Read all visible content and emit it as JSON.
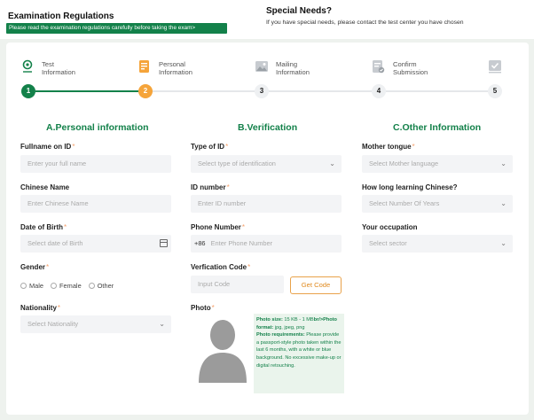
{
  "header": {
    "reg_title": "Examination Regulations",
    "reg_note": "Please read the examination regulations carefully before taking the exam>",
    "special_title": "Special Needs?",
    "special_text": "If you have special needs, please contact the test center you have chosen"
  },
  "steps": [
    {
      "label1": "Test",
      "label2": "Information",
      "number": "1",
      "icon": "location-pin-icon"
    },
    {
      "label1": "Personal",
      "label2": "Information",
      "number": "2",
      "icon": "document-icon"
    },
    {
      "label1": "Mailing",
      "label2": "Information",
      "number": "3",
      "icon": "picture-icon"
    },
    {
      "label1": "Confirm",
      "label2": "Submission",
      "number": "4",
      "icon": "check-document-icon"
    },
    {
      "label1": "",
      "label2": "",
      "number": "5",
      "icon": "checkbox-icon"
    }
  ],
  "colors": {
    "green": "#13814a",
    "orange": "#f5a43a",
    "grey": "#e5e7ea"
  },
  "sections": {
    "a": "A.Personal information",
    "b": "B.Verification",
    "c": "C.Other Information"
  },
  "fields": {
    "fullname": {
      "label": "Fullname on ID",
      "required": "*",
      "placeholder": "Enter your full name"
    },
    "chinese_name": {
      "label": "Chinese Name",
      "placeholder": "Enter Chinese Name"
    },
    "dob": {
      "label": "Date of Birth",
      "required": "*",
      "placeholder": "Select date of Birth"
    },
    "gender": {
      "label": "Gender",
      "required": "*",
      "options": [
        "Male",
        "Female",
        "Other"
      ]
    },
    "nationality": {
      "label": "Nationality",
      "required": "*",
      "placeholder": "Select Nationality"
    },
    "id_type": {
      "label": "Type of ID",
      "required": "*",
      "placeholder": "Select type of identification"
    },
    "id_number": {
      "label": "ID number",
      "required": "*",
      "placeholder": "Enter ID number"
    },
    "phone": {
      "label": "Phone Number",
      "required": "*",
      "prefix": "+86",
      "placeholder": "Enter Phone Number"
    },
    "verification": {
      "label": "Verfication Code",
      "required": "*",
      "placeholder": "Input Code",
      "button": "Get Code"
    },
    "photo": {
      "label": "Photo",
      "required": "*",
      "info_size_label": "Photo size:",
      "info_size": " 15 KB - 1 MB",
      "info_format": "br/>Photo format:",
      "info_format_val": " jpg, jpeg, png",
      "info_req_label": "Photo requirements:",
      "info_req": " Please provide a passport-style photo taken within the last 6 months, with a white or blue background. No excessive make-up or digital retouching."
    },
    "mother_tongue": {
      "label": "Mother tongue",
      "required": "*",
      "placeholder": "Select Mother language"
    },
    "learning": {
      "label": "How long learning Chinese?",
      "placeholder": "Select Number Of Years"
    },
    "occupation": {
      "label": "Your occupation",
      "placeholder": "Select sector"
    }
  }
}
